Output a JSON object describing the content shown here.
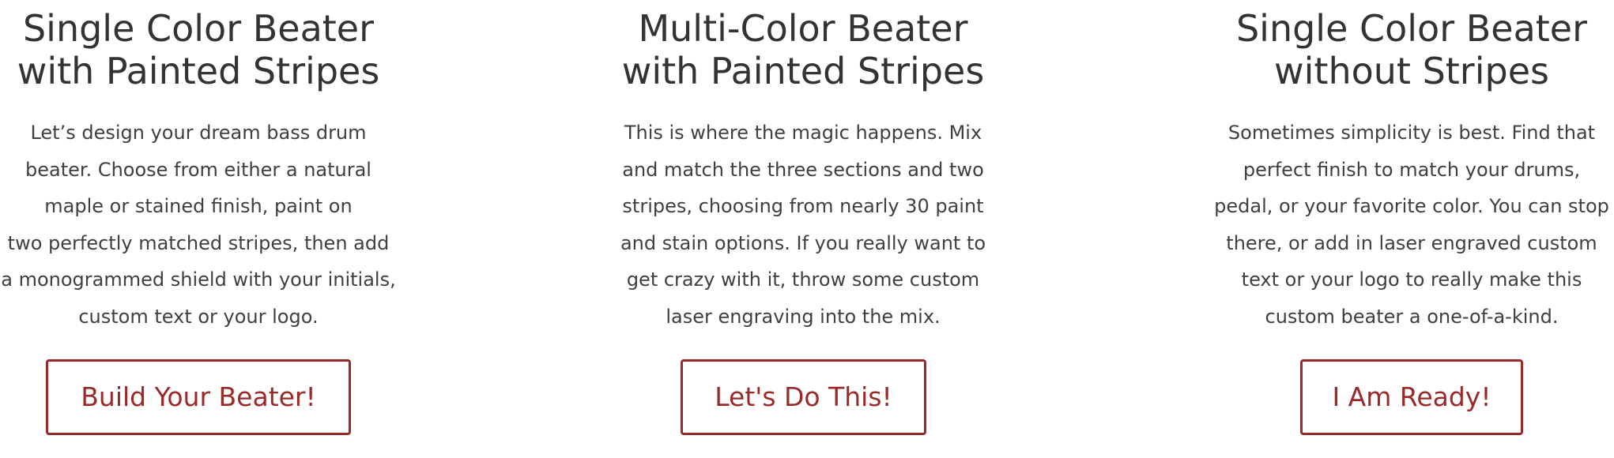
{
  "options": [
    {
      "title_lines": [
        "Single Color Beater",
        "with Painted Stripes"
      ],
      "description_lines": [
        "Let’s design your dream bass drum",
        "beater. Choose from either a natural",
        "maple or stained finish, paint on",
        "two perfectly matched stripes, then add",
        "a monogrammed shield with your initials,",
        "custom text or your logo."
      ],
      "button_label": "Build Your Beater!"
    },
    {
      "title_lines": [
        "Multi-Color Beater",
        "with Painted Stripes"
      ],
      "description_lines": [
        "This is where the magic happens. Mix",
        "and match the three sections and two",
        "stripes, choosing from nearly 30 paint",
        "and stain options. If you really want to",
        "get crazy with it, throw some custom",
        "laser engraving into the mix."
      ],
      "button_label": "Let's Do This!"
    },
    {
      "title_lines": [
        "Single Color Beater",
        "without Stripes"
      ],
      "description_lines": [
        "Sometimes simplicity is best. Find that",
        "perfect finish to match your drums,",
        "pedal, or your favorite color. You can stop",
        "there, or add in laser engraved custom",
        "text or your logo to really make this",
        "custom beater a one-of-a-kind."
      ],
      "button_label": "I Am Ready!"
    }
  ],
  "colors": {
    "accent": "#9a2a2a",
    "heading": "#333333",
    "body_text": "#3f3f3f",
    "background": "#ffffff"
  }
}
